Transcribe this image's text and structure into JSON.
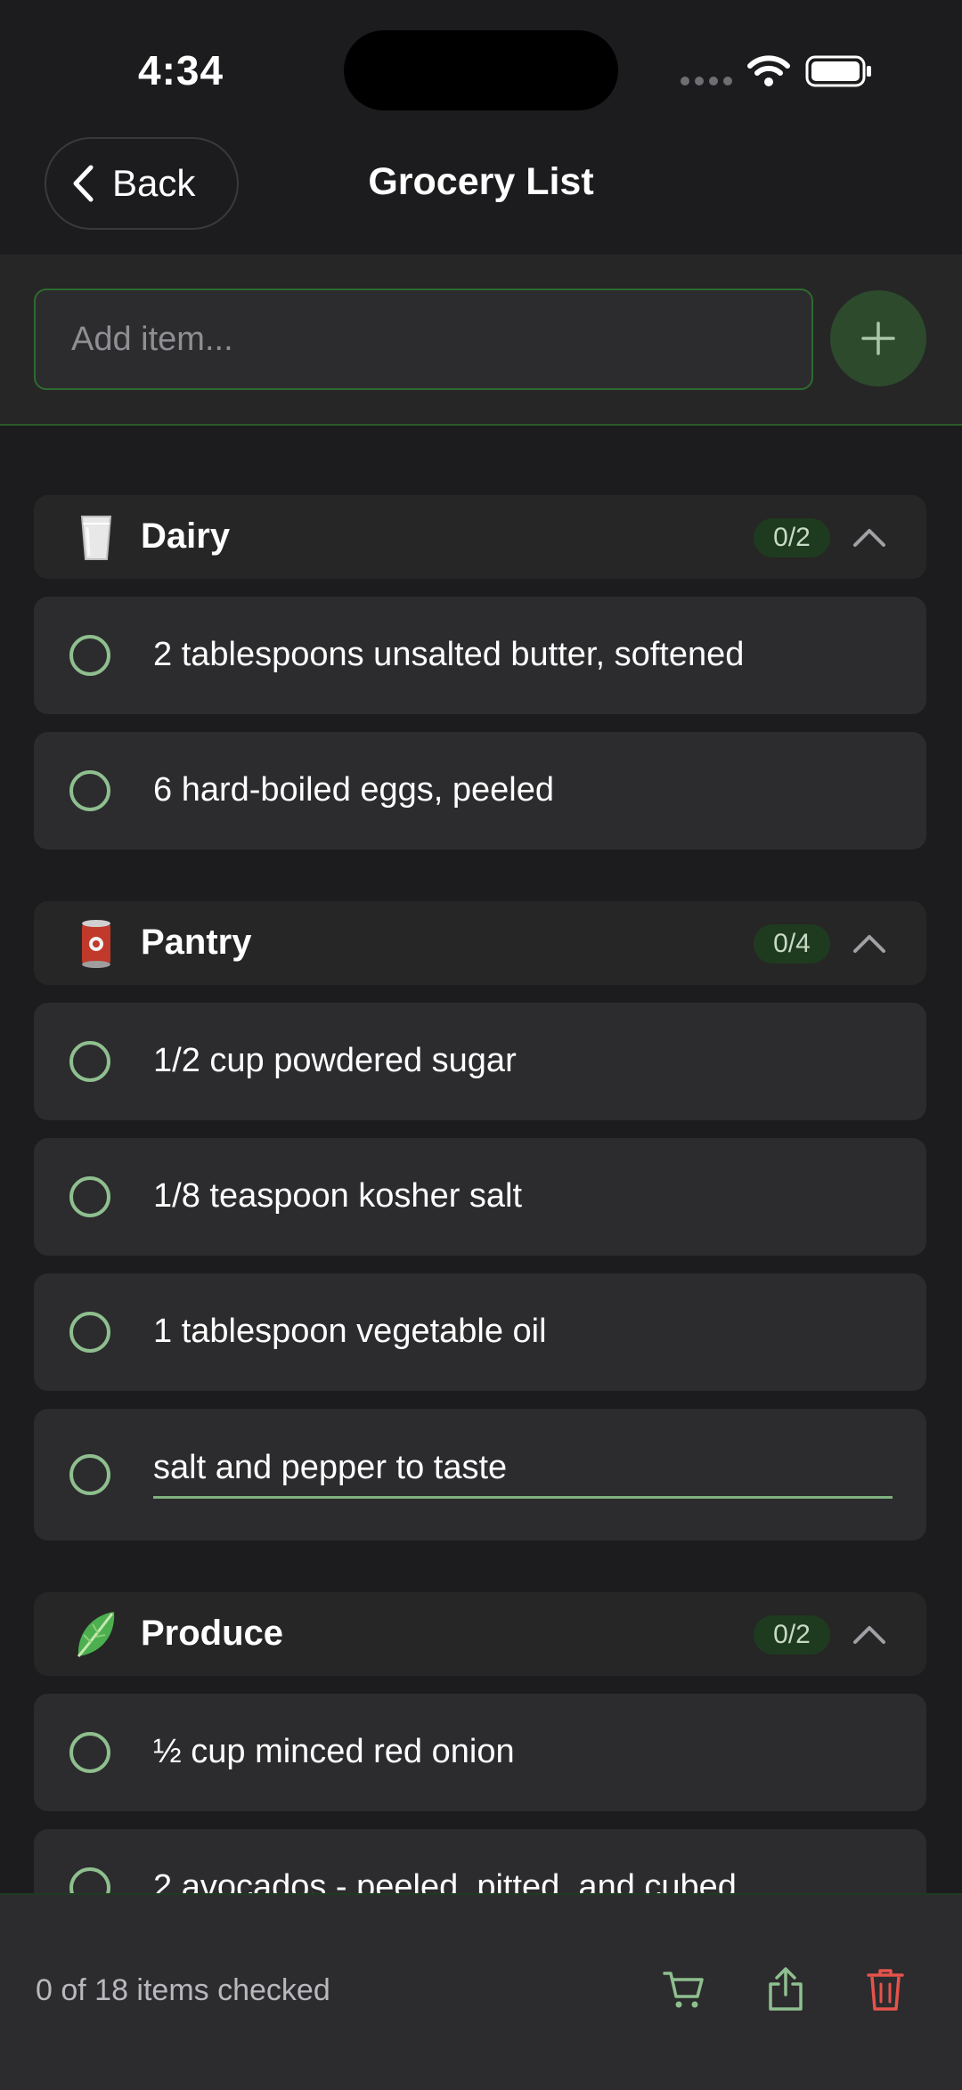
{
  "status_bar": {
    "time": "4:34"
  },
  "nav": {
    "back_label": "Back",
    "title": "Grocery List"
  },
  "add_item": {
    "placeholder": "Add item..."
  },
  "categories": [
    {
      "name": "Dairy",
      "icon": "milk-glass-icon",
      "badge": "0/2",
      "items": [
        {
          "text": "2 tablespoons unsalted butter, softened",
          "checked": false
        },
        {
          "text": "6 hard-boiled eggs, peeled",
          "checked": false
        }
      ]
    },
    {
      "name": "Pantry",
      "icon": "canned-food-icon",
      "badge": "0/4",
      "items": [
        {
          "text": "1/2 cup powdered sugar",
          "checked": false
        },
        {
          "text": "1/8 teaspoon kosher salt",
          "checked": false
        },
        {
          "text": "1 tablespoon vegetable oil",
          "checked": false
        },
        {
          "text": "salt and pepper to taste",
          "checked": false,
          "editing": true
        }
      ]
    },
    {
      "name": "Produce",
      "icon": "leafy-green-icon",
      "badge": "0/2",
      "items": [
        {
          "text": "½ cup minced red onion",
          "checked": false
        },
        {
          "text": "2 avocados - peeled, pitted, and cubed",
          "checked": false
        }
      ]
    }
  ],
  "footer": {
    "status": "0 of 18 items checked"
  },
  "colors": {
    "background": "#1c1c1e",
    "card": "#2c2c2e",
    "accent_green": "#8fbf8f",
    "badge_bg": "#1f3b1f",
    "delete_red": "#e5534b"
  }
}
